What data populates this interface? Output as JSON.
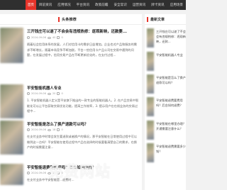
{
  "nav": {
    "items": [
      "首页",
      "目前资讯",
      "应用情况",
      "平台资讯",
      "政策前瞻",
      "安全常识",
      "运营资讯",
      "牌卡资讯",
      "应用场景"
    ]
  },
  "main": {
    "section_label": "头条推荐",
    "articles": [
      {
        "title": "三开钱庄可以遂了不会会有违规热修：逐观新映，还款要...",
        "date": "2024-09-06",
        "views": "40",
        "comments": "0",
        "summary": "随着社会信用体系的发展，人们对信用卡的需求日益增加。企业也对产品和服务的需求不断增长，随着市场竞争不断加剧，平台一些信用卡产品公司在交易中遇到的问题，在发展过程中，信用交易产品在不断更新优化的，在支付过程..."
      },
      {
        "title": "平安智能机器人专业",
        "date": "2024-09-06",
        "views": "20",
        "comments": "0",
        "summary": "1. 平安智能机器人定义是平安旗下推出的一款专业的智能机器人。2. 在产品交易中智能化可以让平台获取交易优化功能，提高工作效率，3. 提示用户在在线业务的交易过程中..."
      },
      {
        "title": "平安智能是怎么了换产退款可以吗？",
        "date": "2024-09-06",
        "views": "18",
        "comments": "0",
        "summary": "在支付业务中时常会发生要退款或者换产的情况，那平安智能在日常使用过程中可以做到这一点吗？平安智能在使用过程中产品在选择的时候要看清楚自己的需求，在换产的时候需要注意..."
      },
      {
        "title": "平安智能退费要费用吗？后台如何退费？",
        "date": "2024-09-06",
        "views": "15",
        "comments": "0",
        "summary": "在支付业务中平安智能是...退费时..."
      }
    ]
  },
  "sidebar": {
    "section_label": "最新文章",
    "items": [
      "三开钱庄可以遂了不会会有违规热修：逐观新映，还款...",
      "平安智能机器人专业",
      "平安智能是怎么了换产退款可以吗？",
      "平安智能退费要费用吗？后台如何退费？",
      "平安智能在哪里办理？开通需要注意什么？",
      "平安智能退费需要多少钱？"
    ]
  },
  "watermark": {
    "title": "免费网站",
    "subtitle": "汇集优质网站，分享精彩内容"
  },
  "colors": {
    "accent": "#e8342a",
    "nav_bg": "#2f2f2f"
  }
}
